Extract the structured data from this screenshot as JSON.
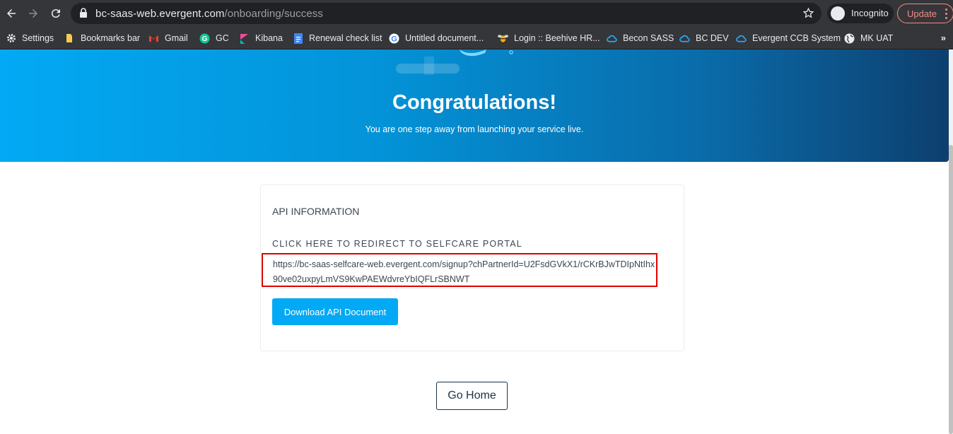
{
  "browser": {
    "url_host": "bc-saas-web.evergent.com",
    "url_path": "/onboarding/success",
    "incognito_label": "Incognito",
    "update_label": "Update",
    "more_bookmarks": "»"
  },
  "bookmarks": [
    {
      "label": "Settings",
      "icon": "gear-icon"
    },
    {
      "label": "Bookmarks bar",
      "icon": "folder-icon"
    },
    {
      "label": "Gmail",
      "icon": "gmail-icon"
    },
    {
      "label": "GC",
      "icon": "grammarly-icon"
    },
    {
      "label": "Kibana",
      "icon": "kibana-icon"
    },
    {
      "label": "Renewal check list",
      "icon": "docs-icon"
    },
    {
      "label": "Untitled document...",
      "icon": "google-icon"
    },
    {
      "label": "Login :: Beehive HR...",
      "icon": "beehive-icon"
    },
    {
      "label": "Becon SASS",
      "icon": "cloud-icon"
    },
    {
      "label": "BC DEV",
      "icon": "cloud-icon"
    },
    {
      "label": "Evergent CCB System",
      "icon": "cloud-icon"
    },
    {
      "label": "MK UAT",
      "icon": "globe-icon"
    }
  ],
  "hero": {
    "title": "Congratulations!",
    "subtitle": "You are one step away from launching your service live."
  },
  "card": {
    "section_title": "API INFORMATION",
    "redirect_label": "CLICK HERE TO REDIRECT TO SELFCARE PORTAL",
    "portal_url": "https://bc-saas-selfcare-web.evergent.com/signup?chPartnerId=U2FsdGVkX1/rCKrBJwTDIpNtIhx90ve02uxpyLmVS9KwPAEWdvreYbIQFLrSBNWT",
    "download_button": "Download API Document"
  },
  "go_home_button": "Go Home",
  "colors": {
    "accent": "#03a9f4",
    "highlight_border": "#e00000",
    "hero_gradient_end": "#0d3f6e",
    "dark_text": "#1c3347"
  }
}
